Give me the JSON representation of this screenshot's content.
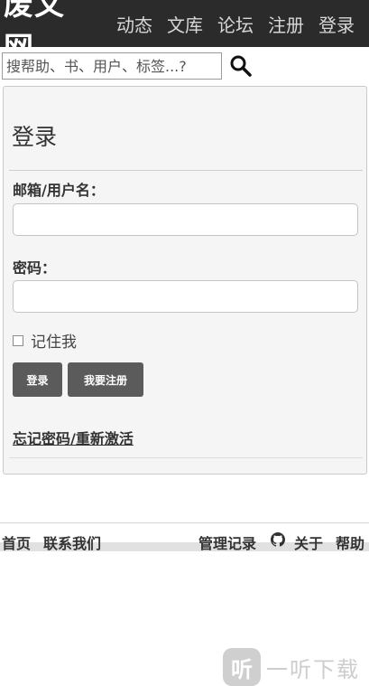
{
  "brand": "废文网",
  "nav": [
    "动态",
    "文库",
    "论坛",
    "注册",
    "登录"
  ],
  "search": {
    "placeholder": "搜帮助、书、用户、标签...?"
  },
  "login": {
    "title": "登录",
    "username_label": "邮箱/用户名：",
    "password_label": "密码：",
    "remember_label": "记住我",
    "login_button": "登录",
    "register_button": "我要注册",
    "forgot_link": "忘记密码/重新激活"
  },
  "footer": {
    "home": "首页",
    "contact": "联系我们",
    "admin_log": "管理记录",
    "about": "关于",
    "help": "帮助"
  },
  "watermark": {
    "logo": "听",
    "text": "一听下载"
  }
}
